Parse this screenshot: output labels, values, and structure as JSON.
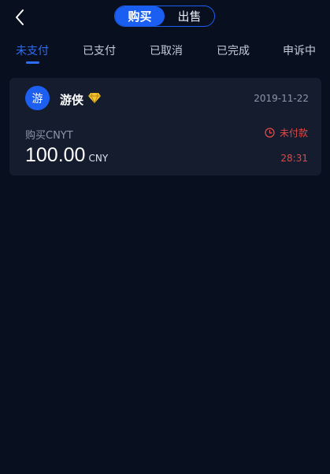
{
  "header": {
    "back_icon": "chevron-left-icon",
    "segments": [
      {
        "label": "购买",
        "active": true
      },
      {
        "label": "出售",
        "active": false
      }
    ]
  },
  "tabs": [
    {
      "label": "未支付",
      "active": true
    },
    {
      "label": "已支付",
      "active": false
    },
    {
      "label": "已取消",
      "active": false
    },
    {
      "label": "已完成",
      "active": false
    },
    {
      "label": "申诉中",
      "active": false
    }
  ],
  "orders": [
    {
      "avatar_text": "游",
      "merchant_name": "游侠",
      "badge_icon": "diamond-icon",
      "date": "2019-11-22",
      "type": "购买CNYT",
      "status": "未付款",
      "status_icon": "clock-icon",
      "amount": "100.00",
      "currency": "CNY",
      "countdown": "28:31"
    }
  ],
  "colors": {
    "background": "#080f1f",
    "card": "#141c2e",
    "accent": "#1b5ef2",
    "alert": "#e04848",
    "diamond": "#f2c230"
  }
}
